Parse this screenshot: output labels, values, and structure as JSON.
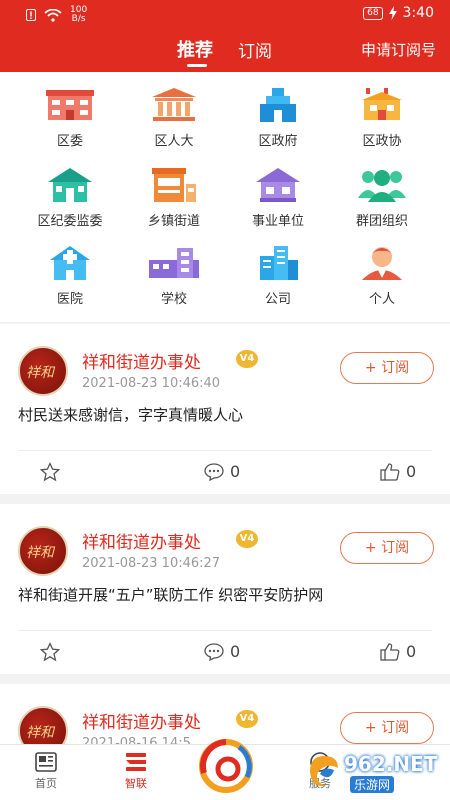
{
  "status_bar": {
    "net_speed_value": "100",
    "net_speed_unit": "B/s",
    "battery": "68",
    "time": "3:40"
  },
  "header": {
    "tabs": [
      {
        "label": "推荐"
      },
      {
        "label": "订阅"
      }
    ],
    "active_tab": "推荐",
    "apply_label": "申请订阅号"
  },
  "categories": [
    {
      "label": "区委",
      "icon": "building-icon"
    },
    {
      "label": "区人大",
      "icon": "hall-icon"
    },
    {
      "label": "区政府",
      "icon": "government-icon"
    },
    {
      "label": "区政协",
      "icon": "pavilion-icon"
    },
    {
      "label": "区纪委监委",
      "icon": "house-icon"
    },
    {
      "label": "乡镇街道",
      "icon": "shop-icon"
    },
    {
      "label": "事业单位",
      "icon": "house-roof-icon"
    },
    {
      "label": "群团组织",
      "icon": "people-group-icon"
    },
    {
      "label": "医院",
      "icon": "hospital-icon"
    },
    {
      "label": "学校",
      "icon": "school-icon"
    },
    {
      "label": "公司",
      "icon": "office-tower-icon"
    },
    {
      "label": "个人",
      "icon": "person-icon"
    }
  ],
  "feed": [
    {
      "publisher": "祥和街道办事处",
      "badge": "V4",
      "time": "2021-08-23 10:46:40",
      "subscribe_label": "+ 订阅",
      "title": "村民送来感谢信，字字真情暖人心",
      "comments": "0",
      "likes": "0"
    },
    {
      "publisher": "祥和街道办事处",
      "badge": "V4",
      "time": "2021-08-23 10:46:27",
      "subscribe_label": "+ 订阅",
      "title": "祥和街道开展“五户”联防工作 织密平安防护网",
      "comments": "0",
      "likes": "0"
    },
    {
      "publisher": "祥和街道办事处",
      "badge": "V4",
      "time": "2021-08-16 14:5",
      "subscribe_label": "+ 订阅"
    }
  ],
  "bottom_nav": [
    {
      "label": "首页"
    },
    {
      "label": "智联"
    },
    {
      "label": "服务"
    }
  ],
  "watermark": {
    "text": "962.NET",
    "sub": "乐游网"
  },
  "colors": {
    "brand_red": "#e02b20",
    "subscribe_orange": "#e05a30",
    "badge_gold": "#f0b630"
  }
}
